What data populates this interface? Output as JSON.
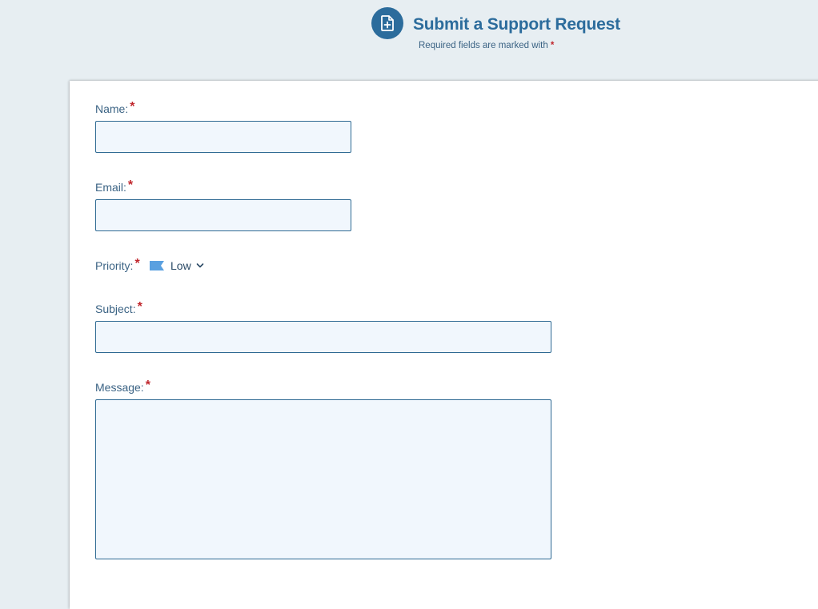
{
  "header": {
    "title": "Submit a Support Request",
    "subtitle": "Required fields are marked with",
    "required_marker": "*",
    "icon": "file-plus-icon"
  },
  "form": {
    "name": {
      "label": "Name:",
      "value": "",
      "placeholder": ""
    },
    "email": {
      "label": "Email:",
      "value": "",
      "placeholder": ""
    },
    "priority": {
      "label": "Priority:",
      "value": "Low",
      "flag_color": "#5aa0e0",
      "icon": "flag-icon"
    },
    "subject": {
      "label": "Subject:",
      "value": "",
      "placeholder": ""
    },
    "message": {
      "label": "Message:",
      "value": "",
      "placeholder": ""
    }
  },
  "colors": {
    "accent": "#2c6c9c",
    "required": "#c0262c",
    "background": "#e7eef2",
    "field_background": "#f1f7fd"
  }
}
